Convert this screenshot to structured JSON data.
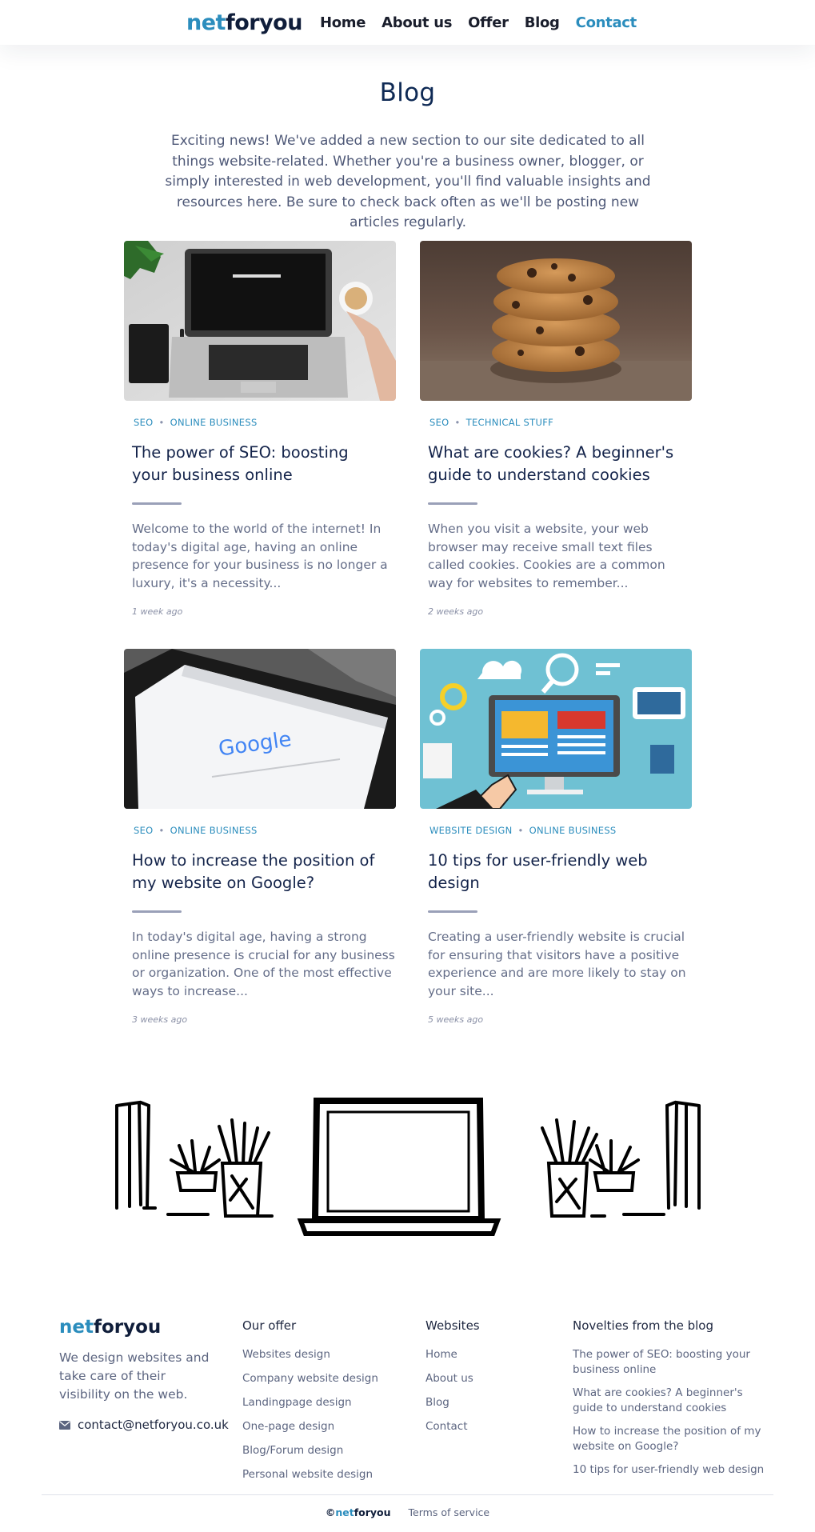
{
  "header": {
    "logo_part1": "net",
    "logo_part2": "foryou",
    "nav": [
      "Home",
      "About us",
      "Offer",
      "Blog",
      "Contact"
    ],
    "active_nav": "Contact"
  },
  "page": {
    "title": "Blog",
    "intro": "Exciting news! We've added a new section to our site dedicated to all things website-related. Whether you're a business owner, blogger, or simply interested in web development, you'll find valuable insights and resources here. Be sure to check back often as we'll be posting new articles regularly."
  },
  "posts": [
    {
      "image": "laptop-desk-photo",
      "tag1": "SEO",
      "tag2": "ONLINE BUSINESS",
      "title": "The power of SEO: boosting your business online",
      "excerpt": "Welcome to the world of the internet! In today's digital age, having an online presence for your business is no longer a luxury, it's a necessity...",
      "date": "1 week ago"
    },
    {
      "image": "cookies-stack-photo",
      "tag1": "SEO",
      "tag2": "TECHNICAL STUFF",
      "title": "What are cookies? A beginner's guide to understand cookies",
      "excerpt": "When you visit a website, your web browser may receive small text files called cookies. Cookies are a common way for websites to remember...",
      "date": "2 weeks ago"
    },
    {
      "image": "tablet-google-photo",
      "tag1": "SEO",
      "tag2": "ONLINE BUSINESS",
      "title": "How to increase the position of my website on Google?",
      "excerpt": "In today's digital age, having a strong online presence is crucial for any business or organization. One of the most effective ways to increase...",
      "date": "3 weeks ago"
    },
    {
      "image": "web-design-illustration",
      "tag1": "WEBSITE DESIGN",
      "tag2": "ONLINE BUSINESS",
      "title": "10 tips for user-friendly web design",
      "excerpt": "Creating a user-friendly website is crucial for ensuring that visitors have a positive experience and are more likely to stay on your site...",
      "date": "5 weeks ago"
    }
  ],
  "illustration_text": {
    "google_logo": "Google"
  },
  "footer": {
    "logo_part1": "net",
    "logo_part2": "foryou",
    "tagline": "We design websites and take care of their visibility on the web.",
    "email": "contact@netforyou.co.uk",
    "offer_heading": "Our offer",
    "offer_links": [
      "Websites design",
      "Company website design",
      "Landingpage design",
      "One-page design",
      "Blog/Forum design",
      "Personal website design"
    ],
    "websites_heading": "Websites",
    "websites_links": [
      "Home",
      "About us",
      "Blog",
      "Contact"
    ],
    "blog_heading": "Novelties from the blog",
    "blog_links": [
      "The power of SEO: boosting your business online",
      "What are cookies? A beginner's guide to understand cookies",
      "How to increase the position of my website on Google?",
      "10 tips for user-friendly web design"
    ],
    "copyright_symbol": "©",
    "copyright_net": "net",
    "copyright_rest": "foryou",
    "terms": "Terms of service"
  },
  "colors": {
    "brand_blue": "#2b8dbd",
    "navy": "#0f1d3a",
    "title_navy": "#13234a",
    "text_gray": "#646d88"
  }
}
